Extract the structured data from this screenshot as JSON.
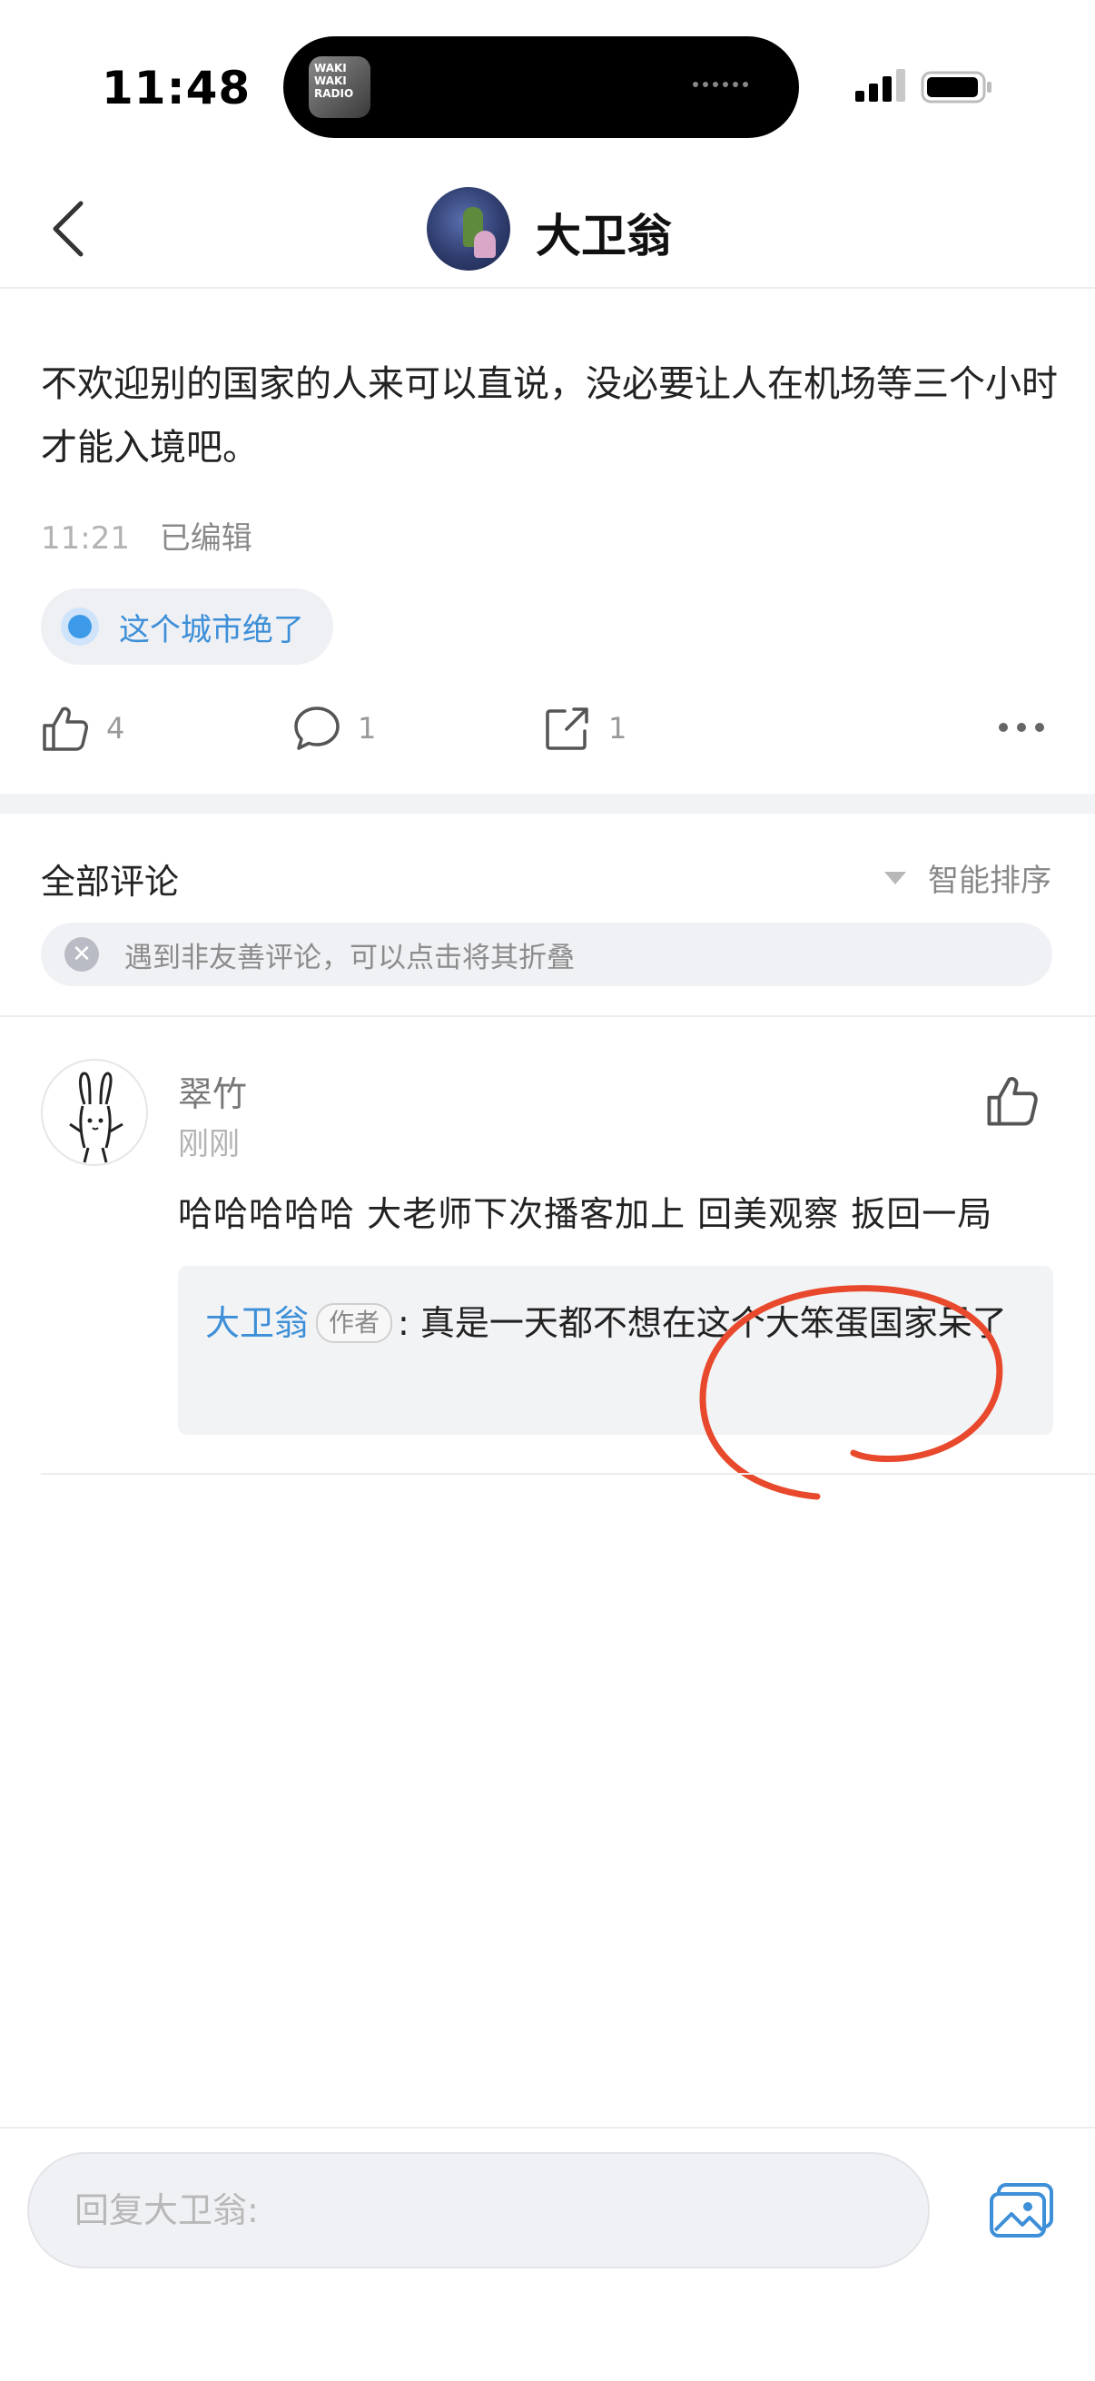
{
  "status_bar": {
    "time": "11:48",
    "now_playing_art_text": "WAKI WAKI RADIO"
  },
  "header": {
    "title": "大卫翁",
    "avatar": "user-avatar-illustration"
  },
  "post": {
    "text": "不欢迎别的国家的人来可以直说，没必要让人在机场等三个小时才能入境吧。",
    "time": "11:21",
    "edited_label": "已编辑",
    "topic": "这个城市绝了",
    "like_count": "4",
    "comment_count": "1",
    "share_count": "1"
  },
  "comments_section": {
    "title": "全部评论",
    "sort_label": "智能排序",
    "tip": "遇到非友善评论，可以点击将其折叠"
  },
  "comments": [
    {
      "author": "翠竹",
      "time": "刚刚",
      "text": "哈哈哈哈哈 大老师下次播客加上 回美观察 扳回一局",
      "reply": {
        "author": "大卫翁",
        "badge": "作者",
        "separator": ":",
        "text": " 真是一天都不想在这个大笨蛋国家呆了"
      }
    }
  ],
  "bottom_bar": {
    "reply_placeholder": "回复大卫翁:"
  },
  "colors": {
    "accent_blue": "#3d8fd8",
    "annotation_red": "#e8482c",
    "muted_text": "#8c8c8c"
  }
}
